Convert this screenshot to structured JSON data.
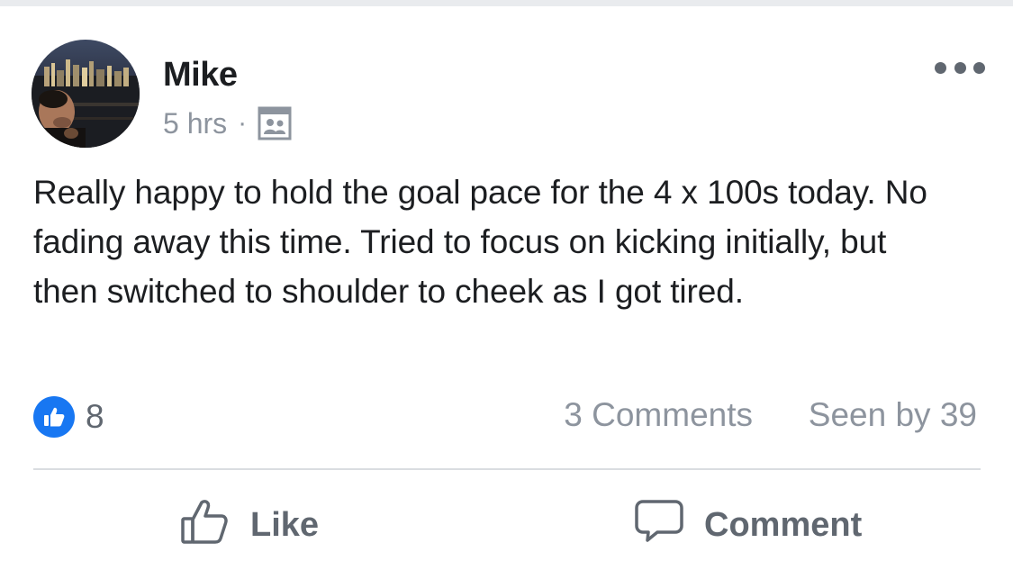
{
  "post": {
    "author": "Mike",
    "time": "5 hrs",
    "separator": "·",
    "audience_icon": "group-audience-icon",
    "text": "Really happy to hold the goal pace for the 4 x 100s today. No fading away this time. Tried to focus on kicking initially, but then switched to shoulder to cheek as I got tired.",
    "reaction_icon": "like-reaction-icon",
    "reaction_count": "8",
    "comments_label": "3 Comments",
    "seen_label": "Seen by 39"
  },
  "actions": {
    "like_label": "Like",
    "comment_label": "Comment"
  },
  "colors": {
    "accent": "#1877f2",
    "secondary_text": "#8d949e",
    "action_text": "#606770",
    "divider": "#dadde1"
  }
}
